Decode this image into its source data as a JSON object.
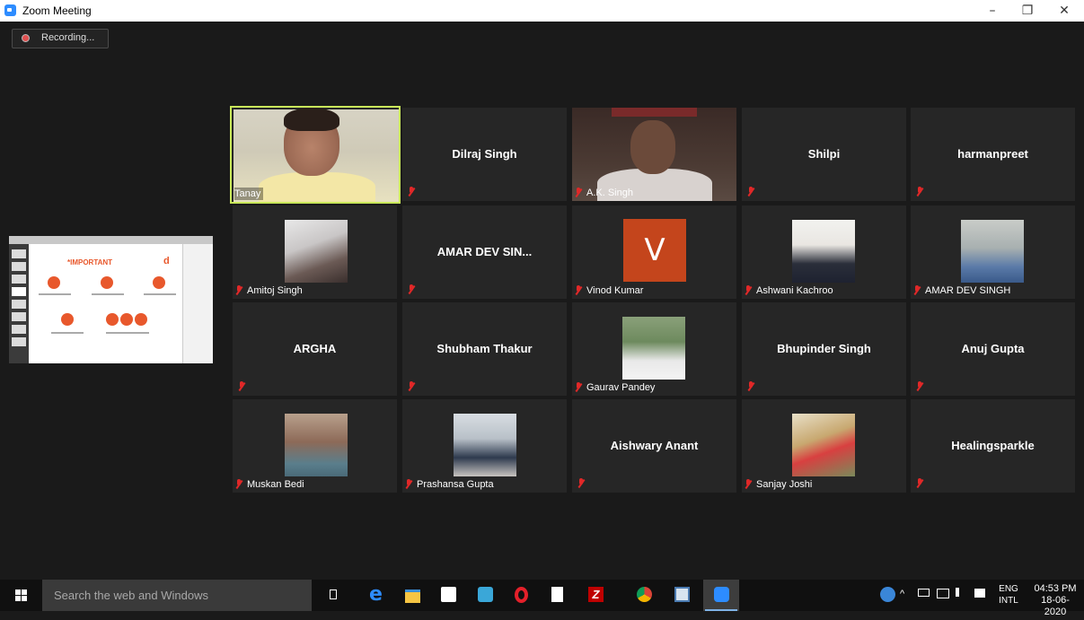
{
  "window": {
    "title": "Zoom Meeting",
    "controls": {
      "minimize": "–",
      "maximize": "❐",
      "close": "✕"
    }
  },
  "recording": {
    "label": "Recording..."
  },
  "shared_screen": {
    "slide_title": "*IMPORTANT"
  },
  "participants": [
    {
      "name": "Tanay",
      "video": true,
      "active_speaker": true
    },
    {
      "name": "Dilraj Singh",
      "video": false,
      "muted": true
    },
    {
      "name": "A.K. Singh",
      "video": true,
      "muted": true
    },
    {
      "name": "Shilpi",
      "video": false,
      "muted": true
    },
    {
      "name": "harmanpreet",
      "video": false,
      "muted": true
    },
    {
      "name": "Amitoj Singh",
      "video": true,
      "muted": true
    },
    {
      "name": "AMAR DEV SIN...",
      "video": false,
      "muted": true
    },
    {
      "name": "Vinod Kumar",
      "video": true,
      "muted": true,
      "avatar_letter": "V"
    },
    {
      "name": "Ashwani Kachroo",
      "video": true,
      "muted": true
    },
    {
      "name": "AMAR DEV SINGH",
      "video": true,
      "muted": true
    },
    {
      "name": "ARGHA",
      "video": false,
      "muted": true
    },
    {
      "name": "Shubham Thakur",
      "video": false,
      "muted": true
    },
    {
      "name": "Gaurav Pandey",
      "video": true,
      "muted": true
    },
    {
      "name": "Bhupinder Singh",
      "video": false,
      "muted": true
    },
    {
      "name": "Anuj Gupta",
      "video": false,
      "muted": true
    },
    {
      "name": "Muskan Bedi",
      "video": true,
      "muted": true
    },
    {
      "name": "Prashansa Gupta",
      "video": true,
      "muted": true
    },
    {
      "name": "Aishwary Anant",
      "video": false,
      "muted": true
    },
    {
      "name": "Sanjay Joshi",
      "video": true,
      "muted": true
    },
    {
      "name": "Healingsparkle",
      "video": false,
      "muted": true
    }
  ],
  "taskbar": {
    "search_placeholder": "Search the web and Windows",
    "language": {
      "line1": "ENG",
      "line2": "INTL"
    },
    "clock": {
      "time": "04:53 PM",
      "date": "18-06-2020"
    }
  },
  "colors": {
    "active_speaker_border": "#c9e85a",
    "mute_icon": "#e02828",
    "tile_bg": "#262626",
    "stage_bg": "#1a1a1a",
    "vinod_avatar": "#c4451c"
  }
}
